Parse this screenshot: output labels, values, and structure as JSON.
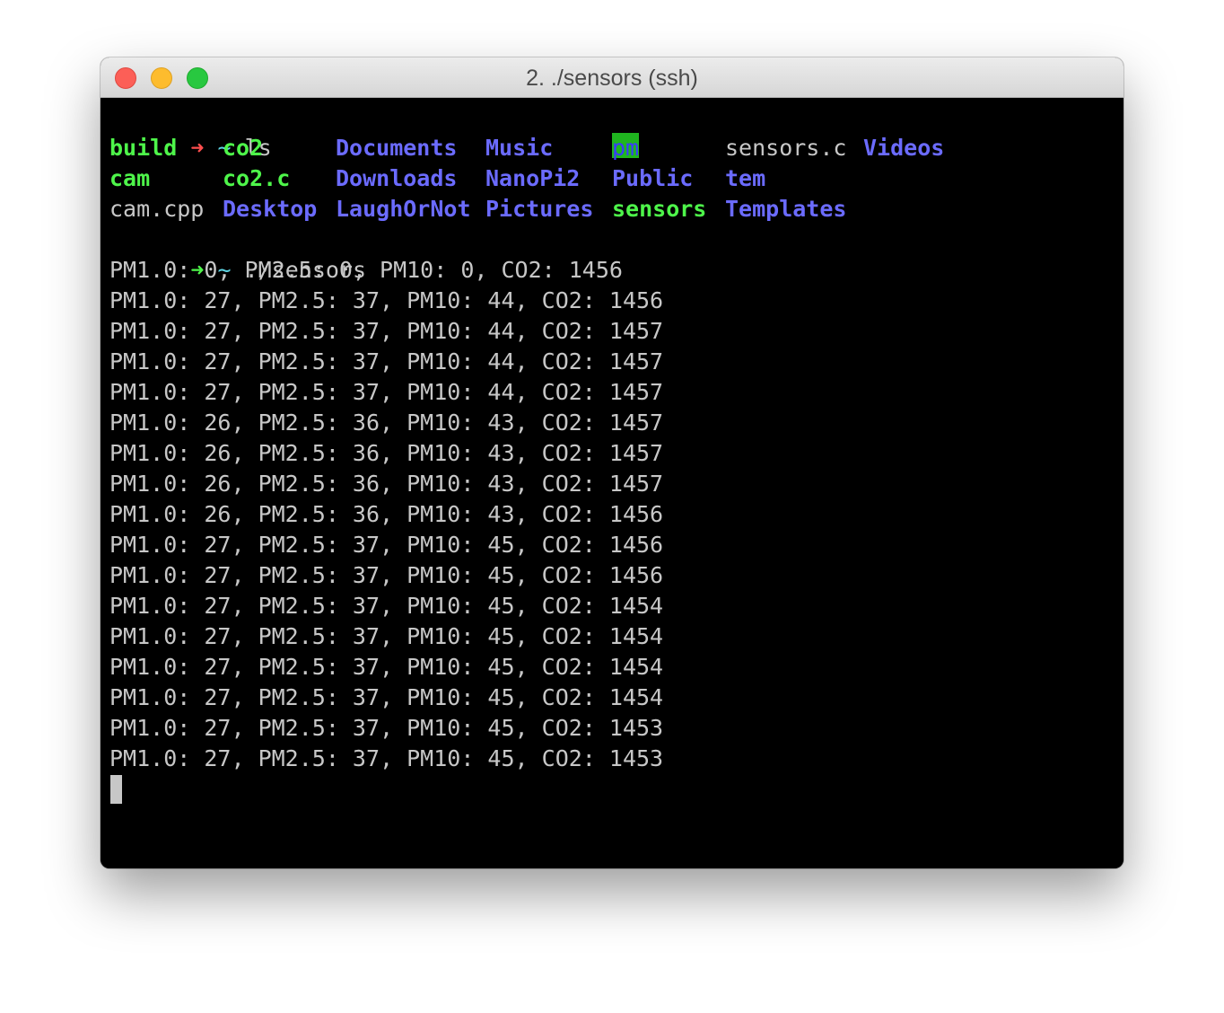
{
  "window": {
    "title": "2. ./sensors (ssh)"
  },
  "prompts": [
    {
      "arrow": "➜",
      "dir": "~",
      "command": "ls",
      "status": "error"
    },
    {
      "arrow": "➜",
      "dir": "~",
      "command": "./sensors",
      "status": "ok"
    }
  ],
  "ls_output": {
    "rows": [
      [
        {
          "name": "build",
          "kind": "exec"
        },
        {
          "name": "co2",
          "kind": "exec"
        },
        {
          "name": "Documents",
          "kind": "dir"
        },
        {
          "name": "Music",
          "kind": "dir"
        },
        {
          "name": "pm",
          "kind": "highlight"
        },
        {
          "name": "sensors.c",
          "kind": "plain"
        },
        {
          "name": "Videos",
          "kind": "dir"
        }
      ],
      [
        {
          "name": "cam",
          "kind": "exec"
        },
        {
          "name": "co2.c",
          "kind": "exec"
        },
        {
          "name": "Downloads",
          "kind": "dir"
        },
        {
          "name": "NanoPi2",
          "kind": "dir"
        },
        {
          "name": "Public",
          "kind": "dir"
        },
        {
          "name": "tem",
          "kind": "dir"
        }
      ],
      [
        {
          "name": "cam.cpp",
          "kind": "plain"
        },
        {
          "name": "Desktop",
          "kind": "dir"
        },
        {
          "name": "LaughOrNot",
          "kind": "dir"
        },
        {
          "name": "Pictures",
          "kind": "dir"
        },
        {
          "name": "sensors",
          "kind": "exec"
        },
        {
          "name": "Templates",
          "kind": "dir"
        }
      ]
    ]
  },
  "sensor_output": [
    "PM1.0: 0, PM2.5: 0, PM10: 0, CO2: 1456",
    "PM1.0: 27, PM2.5: 37, PM10: 44, CO2: 1456",
    "PM1.0: 27, PM2.5: 37, PM10: 44, CO2: 1457",
    "PM1.0: 27, PM2.5: 37, PM10: 44, CO2: 1457",
    "PM1.0: 27, PM2.5: 37, PM10: 44, CO2: 1457",
    "PM1.0: 26, PM2.5: 36, PM10: 43, CO2: 1457",
    "PM1.0: 26, PM2.5: 36, PM10: 43, CO2: 1457",
    "PM1.0: 26, PM2.5: 36, PM10: 43, CO2: 1457",
    "PM1.0: 26, PM2.5: 36, PM10: 43, CO2: 1456",
    "PM1.0: 27, PM2.5: 37, PM10: 45, CO2: 1456",
    "PM1.0: 27, PM2.5: 37, PM10: 45, CO2: 1456",
    "PM1.0: 27, PM2.5: 37, PM10: 45, CO2: 1454",
    "PM1.0: 27, PM2.5: 37, PM10: 45, CO2: 1454",
    "PM1.0: 27, PM2.5: 37, PM10: 45, CO2: 1454",
    "PM1.0: 27, PM2.5: 37, PM10: 45, CO2: 1454",
    "PM1.0: 27, PM2.5: 37, PM10: 45, CO2: 1453",
    "PM1.0: 27, PM2.5: 37, PM10: 45, CO2: 1453"
  ],
  "colors": {
    "error_arrow": "#ff4e4e",
    "ok_arrow": "#4ef54a",
    "executable": "#4ef54a",
    "directory": "#6b6bff",
    "plain_text": "#c7c7c7",
    "terminal_bg": "#000000"
  }
}
